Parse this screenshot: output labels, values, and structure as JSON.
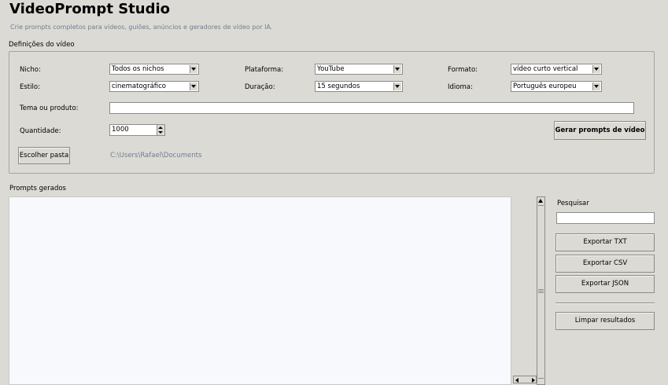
{
  "header": {
    "title": "VideoPrompt Studio",
    "subtitle": "Crie prompts completos para vídeos, guiões, anúncios e geradores de vídeo por IA."
  },
  "settings": {
    "section_label": "Definições do vídeo",
    "niche": {
      "label": "Nicho:",
      "value": "Todos os nichos"
    },
    "platform": {
      "label": "Plataforma:",
      "value": "YouTube"
    },
    "format": {
      "label": "Formato:",
      "value": "vídeo curto vertical"
    },
    "style": {
      "label": "Estilo:",
      "value": "cinematográfico"
    },
    "duration": {
      "label": "Duração:",
      "value": "15 segundos"
    },
    "language": {
      "label": "Idioma:",
      "value": "Português europeu"
    },
    "topic": {
      "label": "Tema ou produto:",
      "value": ""
    },
    "quantity": {
      "label": "Quantidade:",
      "value": "1000"
    },
    "generate_button": "Gerar prompts de vídeo",
    "choose_folder_button": "Escolher pasta",
    "folder_path": "C:\\Users\\Rafael\\Documents"
  },
  "results": {
    "section_label": "Prompts gerados",
    "search_label": "Pesquisar",
    "search_value": "",
    "export_txt": "Exportar TXT",
    "export_csv": "Exportar CSV",
    "export_json": "Exportar JSON",
    "clear": "Limpar resultados"
  }
}
